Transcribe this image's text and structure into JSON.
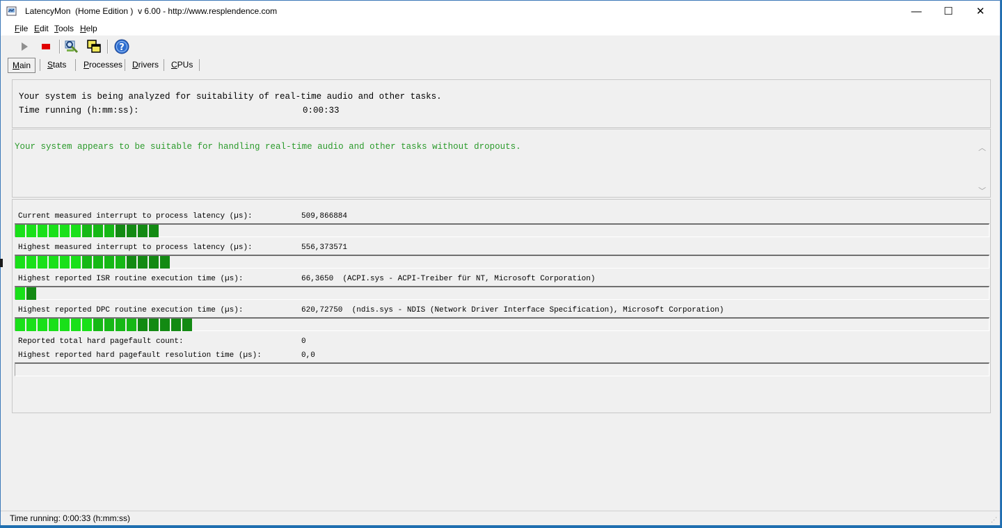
{
  "window": {
    "title": "LatencyMon  (Home Edition )  v 6.00 - http://www.resplendence.com",
    "minimize_glyph": "—",
    "maximize_glyph": "☐",
    "close_glyph": "✕"
  },
  "menu": [
    {
      "accel": "F",
      "rest": "ile"
    },
    {
      "accel": "E",
      "rest": "dit"
    },
    {
      "accel": "T",
      "rest": "ools"
    },
    {
      "accel": "H",
      "rest": "elp"
    }
  ],
  "toolbar": {
    "icons": [
      "play-icon",
      "stop-icon",
      "analyze-icon",
      "windows-icon",
      "help-icon"
    ]
  },
  "tabs": [
    {
      "accel": "M",
      "rest": "ain",
      "active": true
    },
    {
      "accel": "S",
      "rest": "tats",
      "active": false
    },
    {
      "accel": "P",
      "rest": "rocesses",
      "active": false
    },
    {
      "accel": "D",
      "rest": "rivers",
      "active": false
    },
    {
      "accel": "C",
      "rest": "PUs",
      "active": false
    }
  ],
  "status_panel": {
    "line1": "Your system is being analyzed for suitability of real-time audio and other tasks.",
    "time_label": "Time running (h:mm:ss):",
    "time_value": "0:00:33"
  },
  "verdict": {
    "message": "Your system appears to be suitable for handling real-time audio and other tasks without dropouts.",
    "color": "#2a9a2a"
  },
  "metrics": [
    {
      "label": "Current measured interrupt to process latency (µs):",
      "value": "509,866884",
      "detail": "",
      "bar_segments": 13
    },
    {
      "label": "Highest measured interrupt to process latency (µs):",
      "value": "556,373571",
      "detail": "",
      "bar_segments": 14
    },
    {
      "label": "Highest reported ISR routine execution time (µs):",
      "value": "66,3650",
      "detail": "(ACPI.sys - ACPI-Treiber für NT, Microsoft Corporation)",
      "bar_segments": 2
    },
    {
      "label": "Highest reported DPC routine execution time (µs):",
      "value": "620,72750",
      "detail": "(ndis.sys - NDIS (Network Driver Interface Specification), Microsoft Corporation)",
      "bar_segments": 16
    },
    {
      "label": "Reported total hard pagefault count:",
      "value": "0",
      "detail": ""
    },
    {
      "label": "Highest reported hard pagefault resolution time (µs):",
      "value": "0,0",
      "detail": "",
      "bar_segments": 0
    }
  ],
  "bar_colors": {
    "light": "#19e019",
    "mid": "#16b816",
    "dark": "#138a13"
  },
  "statusbar": {
    "text": "Time running: 0:00:33  (h:mm:ss)"
  }
}
